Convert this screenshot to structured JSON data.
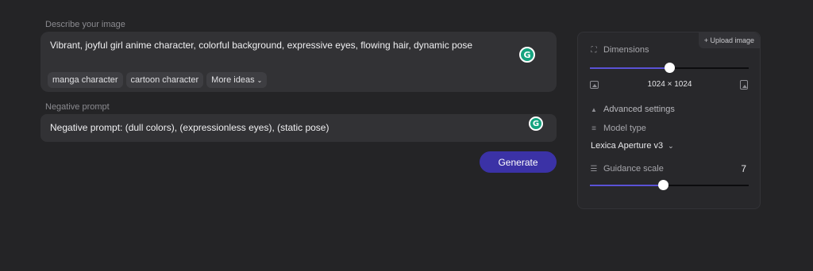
{
  "prompt": {
    "label": "Describe your image",
    "text": "Vibrant, joyful girl anime character, colorful background, expressive eyes, flowing hair, dynamic pose",
    "chips": [
      "manga character",
      "cartoon character"
    ],
    "more_ideas": "More ideas"
  },
  "negative": {
    "label": "Negative prompt",
    "text": "Negative prompt: (dull colors), (expressionless eyes), (static pose)"
  },
  "grammarly_icon": "G",
  "generate_label": "Generate",
  "panel": {
    "upload_label": "+ Upload image",
    "dimensions_label": "Dimensions",
    "dimensions_value": "1024 × 1024",
    "dimensions_slider": 0.5,
    "advanced_label": "Advanced settings",
    "model_type_label": "Model type",
    "model_value": "Lexica Aperture v3",
    "guidance_label": "Guidance scale",
    "guidance_value": "7",
    "guidance_slider": 0.46
  },
  "colors": {
    "accent": "#3b32a6",
    "slider_fill": "#5a52d6",
    "grammarly": "#15a37f"
  }
}
